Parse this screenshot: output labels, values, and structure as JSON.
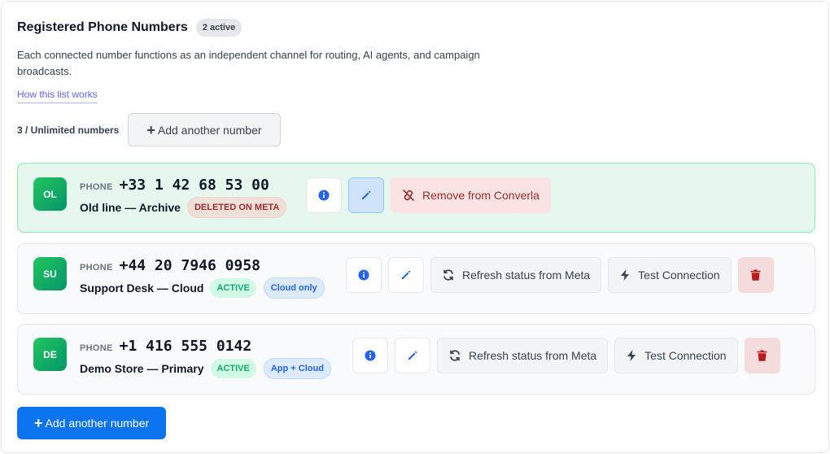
{
  "header": {
    "title": "Registered Phone Numbers",
    "active_count": "2 active",
    "description": "Each connected number functions as an independent channel for routing, AI agents, and campaign broadcasts.",
    "help_link": "How this list works"
  },
  "quota": {
    "label": "3 / Unlimited numbers",
    "add_button": "Add another number"
  },
  "phone_tag": "PHONE",
  "cards": [
    {
      "initials": "OL",
      "number": "+33 1 42 68 53 00",
      "name": "Old line — Archive",
      "status": "DELETED ON META",
      "remove_label": "Remove from Converla"
    },
    {
      "initials": "SU",
      "number": "+44 20 7946 0958",
      "name": "Support Desk — Cloud",
      "status": "ACTIVE",
      "mode": "Cloud only",
      "refresh_label": "Refresh status from Meta",
      "test_label": "Test Connection"
    },
    {
      "initials": "DE",
      "number": "+1 416 555 0142",
      "name": "Demo Store — Primary",
      "status": "ACTIVE",
      "mode": "App + Cloud",
      "refresh_label": "Refresh status from Meta",
      "test_label": "Test Connection"
    }
  ],
  "footer": {
    "add_button": "Add another number"
  },
  "colors": {
    "accent": "#0d74f0",
    "deleted_card_bg": "#e6f7ee",
    "active_badge": "#10a870",
    "danger": "#9a2c2c"
  }
}
